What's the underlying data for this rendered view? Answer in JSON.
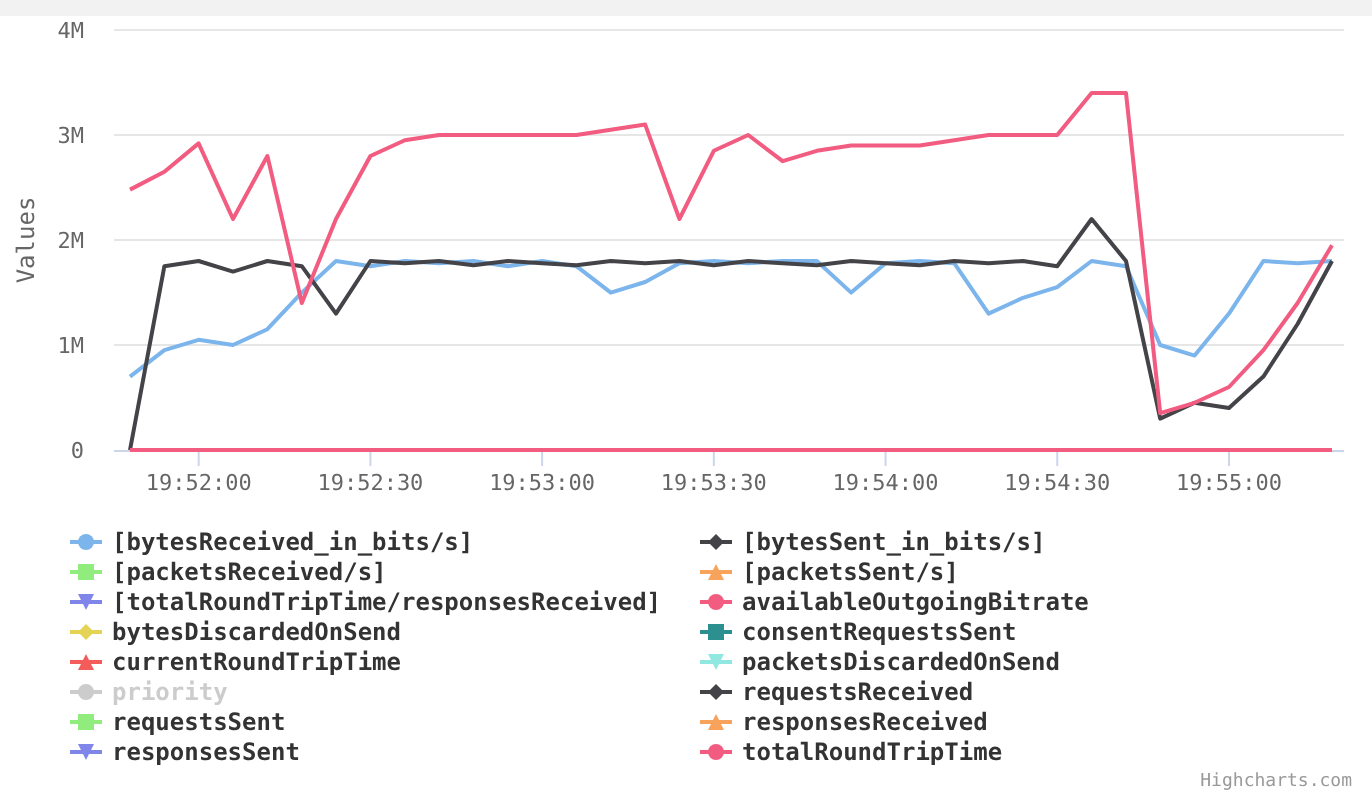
{
  "chart_data": {
    "type": "line",
    "ylabel": "Values",
    "ylim": [
      0,
      4000000
    ],
    "grid": true,
    "legend": true,
    "categories": [
      null,
      null,
      "19:52:00",
      null,
      null,
      null,
      null,
      "19:52:30",
      null,
      null,
      null,
      null,
      "19:53:00",
      null,
      null,
      null,
      null,
      "19:53:30",
      null,
      null,
      null,
      null,
      "19:54:00",
      null,
      null,
      null,
      null,
      "19:54:30",
      null,
      null,
      null,
      null,
      "19:55:00",
      null,
      null,
      null
    ],
    "yticks": [
      {
        "value": 0,
        "label": "0"
      },
      {
        "value": 1000000,
        "label": "1M"
      },
      {
        "value": 2000000,
        "label": "2M"
      },
      {
        "value": 3000000,
        "label": "3M"
      },
      {
        "value": 4000000,
        "label": "4M"
      }
    ],
    "series": [
      {
        "name": "[bytesReceived_in_bits/s]",
        "color": "#7cb5ec",
        "values": [
          700000,
          950000,
          1050000,
          1000000,
          1150000,
          1500000,
          1800000,
          1750000,
          1800000,
          1780000,
          1800000,
          1750000,
          1800000,
          1750000,
          1500000,
          1600000,
          1780000,
          1800000,
          1780000,
          1800000,
          1800000,
          1500000,
          1780000,
          1800000,
          1780000,
          1300000,
          1450000,
          1550000,
          1800000,
          1750000,
          1000000,
          900000,
          1300000,
          1800000,
          1780000,
          1800000
        ]
      },
      {
        "name": "[bytesSent_in_bits/s]",
        "color": "#434348",
        "values": [
          0,
          1750000,
          1800000,
          1700000,
          1800000,
          1750000,
          1300000,
          1800000,
          1780000,
          1800000,
          1760000,
          1800000,
          1780000,
          1760000,
          1800000,
          1780000,
          1800000,
          1760000,
          1800000,
          1780000,
          1760000,
          1800000,
          1780000,
          1760000,
          1800000,
          1780000,
          1800000,
          1750000,
          2200000,
          1800000,
          300000,
          450000,
          400000,
          700000,
          1200000,
          1800000
        ]
      },
      {
        "name": "[packetsReceived/s]",
        "color": "#90ed7d",
        "values": [
          null,
          null,
          null,
          null,
          null,
          null,
          null,
          null,
          null,
          null,
          null,
          null,
          null,
          null,
          null,
          null,
          null,
          null,
          null,
          null,
          null,
          null,
          null,
          null,
          null,
          null,
          null,
          null,
          null,
          null,
          null,
          null,
          null,
          null,
          null,
          null
        ]
      },
      {
        "name": "[packetsSent/s]",
        "color": "#f7a35c",
        "values": [
          null,
          null,
          null,
          null,
          null,
          null,
          null,
          null,
          null,
          null,
          null,
          null,
          null,
          null,
          null,
          null,
          null,
          null,
          null,
          null,
          null,
          null,
          null,
          null,
          null,
          null,
          null,
          null,
          null,
          null,
          null,
          null,
          null,
          null,
          null,
          null
        ]
      },
      {
        "name": "[totalRoundTripTime/responsesReceived]",
        "color": "#8085e9",
        "values": [
          null,
          null,
          null,
          null,
          null,
          null,
          null,
          null,
          null,
          null,
          null,
          null,
          null,
          null,
          null,
          null,
          null,
          null,
          null,
          null,
          null,
          null,
          null,
          null,
          null,
          null,
          null,
          null,
          null,
          null,
          null,
          null,
          null,
          null,
          null,
          null
        ]
      },
      {
        "name": "availableOutgoingBitrate",
        "color": "#f15c80",
        "values": [
          2480000,
          2650000,
          2920000,
          2200000,
          2800000,
          1400000,
          2200000,
          2800000,
          2950000,
          3000000,
          3000000,
          3000000,
          3000000,
          3000000,
          3050000,
          3100000,
          2200000,
          2850000,
          3000000,
          2750000,
          2850000,
          2900000,
          2900000,
          2900000,
          2950000,
          3000000,
          3000000,
          3000000,
          3400000,
          3400000,
          350000,
          450000,
          600000,
          950000,
          1400000,
          1950000
        ]
      },
      {
        "name": "bytesDiscardedOnSend",
        "color": "#e4d354",
        "values": [
          null,
          null,
          null,
          null,
          null,
          null,
          null,
          null,
          null,
          null,
          null,
          null,
          null,
          null,
          null,
          null,
          null,
          null,
          null,
          null,
          null,
          null,
          null,
          null,
          null,
          null,
          null,
          null,
          null,
          null,
          null,
          null,
          null,
          null,
          null,
          null
        ]
      },
      {
        "name": "consentRequestsSent",
        "color": "#2b908f",
        "values": [
          null,
          null,
          null,
          null,
          null,
          null,
          null,
          null,
          null,
          null,
          null,
          null,
          null,
          null,
          null,
          null,
          null,
          null,
          null,
          null,
          null,
          null,
          null,
          null,
          null,
          null,
          null,
          null,
          null,
          null,
          null,
          null,
          null,
          null,
          null,
          null
        ]
      },
      {
        "name": "currentRoundTripTime",
        "color": "#f45b5b",
        "values": [
          null,
          null,
          null,
          null,
          null,
          null,
          null,
          null,
          null,
          null,
          null,
          null,
          null,
          null,
          null,
          null,
          null,
          null,
          null,
          null,
          null,
          null,
          null,
          null,
          null,
          null,
          null,
          null,
          null,
          null,
          null,
          null,
          null,
          null,
          null,
          null
        ]
      },
      {
        "name": "packetsDiscardedOnSend",
        "color": "#91e8e1",
        "values": [
          null,
          null,
          null,
          null,
          null,
          null,
          null,
          null,
          null,
          null,
          null,
          null,
          null,
          null,
          null,
          null,
          null,
          null,
          null,
          null,
          null,
          null,
          null,
          null,
          null,
          null,
          null,
          null,
          null,
          null,
          null,
          null,
          null,
          null,
          null,
          null
        ]
      },
      {
        "name": "priority",
        "color": "#cccccc",
        "values": [
          null,
          null,
          null,
          null,
          null,
          null,
          null,
          null,
          null,
          null,
          null,
          null,
          null,
          null,
          null,
          null,
          null,
          null,
          null,
          null,
          null,
          null,
          null,
          null,
          null,
          null,
          null,
          null,
          null,
          null,
          null,
          null,
          null,
          null,
          null,
          null
        ]
      },
      {
        "name": "requestsReceived",
        "color": "#434348",
        "values": [
          null,
          null,
          null,
          null,
          null,
          null,
          null,
          null,
          null,
          null,
          null,
          null,
          null,
          null,
          null,
          null,
          null,
          null,
          null,
          null,
          null,
          null,
          null,
          null,
          null,
          null,
          null,
          null,
          null,
          null,
          null,
          null,
          null,
          null,
          null,
          null
        ]
      },
      {
        "name": "requestsSent",
        "color": "#90ed7d",
        "values": [
          null,
          null,
          null,
          null,
          null,
          null,
          null,
          null,
          null,
          null,
          null,
          null,
          null,
          null,
          null,
          null,
          null,
          null,
          null,
          null,
          null,
          null,
          null,
          null,
          null,
          null,
          null,
          null,
          null,
          null,
          null,
          null,
          null,
          null,
          null,
          null
        ]
      },
      {
        "name": "responsesReceived",
        "color": "#f7a35c",
        "values": [
          null,
          null,
          null,
          null,
          null,
          null,
          null,
          null,
          null,
          null,
          null,
          null,
          null,
          null,
          null,
          null,
          null,
          null,
          null,
          null,
          null,
          null,
          null,
          null,
          null,
          null,
          null,
          null,
          null,
          null,
          null,
          null,
          null,
          null,
          null,
          null
        ]
      },
      {
        "name": "responsesSent",
        "color": "#8085e9",
        "values": [
          null,
          null,
          null,
          null,
          null,
          null,
          null,
          null,
          null,
          null,
          null,
          null,
          null,
          null,
          null,
          null,
          null,
          null,
          null,
          null,
          null,
          null,
          null,
          null,
          null,
          null,
          null,
          null,
          null,
          null,
          null,
          null,
          null,
          null,
          null,
          null
        ]
      },
      {
        "name": "totalRoundTripTime",
        "color": "#f15c80",
        "values": [
          0,
          0,
          0,
          0,
          0,
          0,
          0,
          0,
          0,
          0,
          0,
          0,
          0,
          0,
          0,
          0,
          0,
          0,
          0,
          0,
          0,
          0,
          0,
          0,
          0,
          0,
          0,
          0,
          0,
          0,
          0,
          0,
          0,
          0,
          0,
          0
        ]
      }
    ]
  },
  "legend_items": [
    {
      "kind": "circle",
      "visible": true
    },
    {
      "kind": "diamond",
      "visible": true
    },
    {
      "kind": "square",
      "visible": true
    },
    {
      "kind": "triangle",
      "visible": true
    },
    {
      "kind": "triangle-down",
      "visible": true
    },
    {
      "kind": "circle",
      "visible": true
    },
    {
      "kind": "diamond",
      "visible": true
    },
    {
      "kind": "square",
      "visible": true
    },
    {
      "kind": "triangle",
      "visible": true
    },
    {
      "kind": "triangle-down",
      "visible": true
    },
    {
      "kind": "circle",
      "visible": false
    },
    {
      "kind": "diamond",
      "visible": true
    },
    {
      "kind": "square",
      "visible": true
    },
    {
      "kind": "triangle",
      "visible": true
    },
    {
      "kind": "triangle-down",
      "visible": true
    },
    {
      "kind": "circle",
      "visible": true
    }
  ],
  "credits": "Highcharts.com"
}
